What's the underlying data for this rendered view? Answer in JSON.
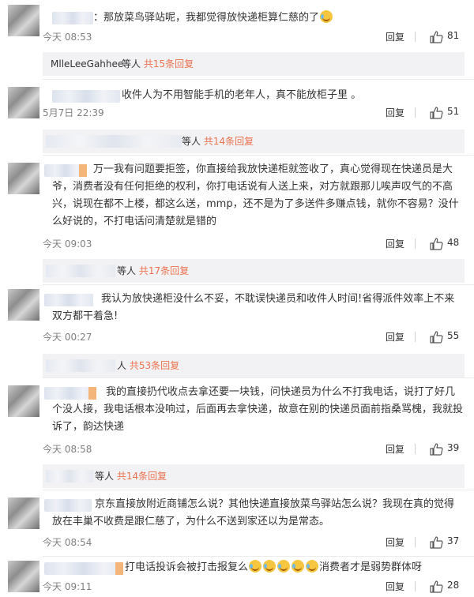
{
  "reply_label": "回复",
  "comments": [
    {
      "text": "：那放菜鸟驿站呢，我都觉得放快递柜算仁慈的了",
      "emoji_count": 1,
      "time": "今天 08:53",
      "likes": "81",
      "thread": {
        "user": "MlleLeeGahhee",
        "suffix": "等人",
        "link": "共15条回复"
      }
    },
    {
      "text": "收件人为不用智能手机的老年人，真不能放柜子里 。",
      "time": "5月7日 22:39",
      "likes": "51",
      "thread": {
        "user": "",
        "suffix": "等人",
        "link": "共14条回复"
      }
    },
    {
      "text": "万一我有问题要拒签，你直接给我放快递柜就签收了，真心觉得现在快递员是大爷，消费者没有任何拒绝的权利，你打电话说有人送上来，对方就跟那儿唉声叹气的不高兴，说现在都不上楼，都这么送，mmp，还不是为了多送件多赚点钱，就你不容易？没什么好说的，不打电话问清楚就是错的",
      "time": "今天 09:03",
      "likes": "48",
      "thread": {
        "user": "",
        "suffix": "等人",
        "link": "共17条回复"
      }
    },
    {
      "text": "我认为放快递柜没什么不妥，不耽误快递员和收件人时间!省得派件效率上不来双方都干着急!",
      "time": "今天 00:27",
      "likes": "55",
      "thread": {
        "user": "",
        "suffix": "人",
        "link": "共53条回复"
      }
    },
    {
      "text": "我的直接扔代收点去拿还要一块钱，问快递员为什么不打我电话，说打了好几个没人接，我电话根本没响过，后面再去拿快递，故意在别的快递员面前指桑骂槐，我就投诉了，韵达快递",
      "time": "今天 08:58",
      "likes": "39",
      "thread": {
        "user": "",
        "suffix": "等人",
        "link": "共14条回复"
      }
    },
    {
      "text": "京东直接放附近商铺怎么说？其他快递直接放菜鸟驿站怎么说？我现在真的觉得放在丰巢不收费是跟仁慈了，为什么不送到家还以为是常态。",
      "time": "今天 08:54",
      "likes": "37"
    },
    {
      "text": "打电话投诉会被打击报复么",
      "text_after": "消费者才是弱势群体呀",
      "emoji_count": 5,
      "time": "今天 09:11",
      "likes": "28"
    }
  ]
}
